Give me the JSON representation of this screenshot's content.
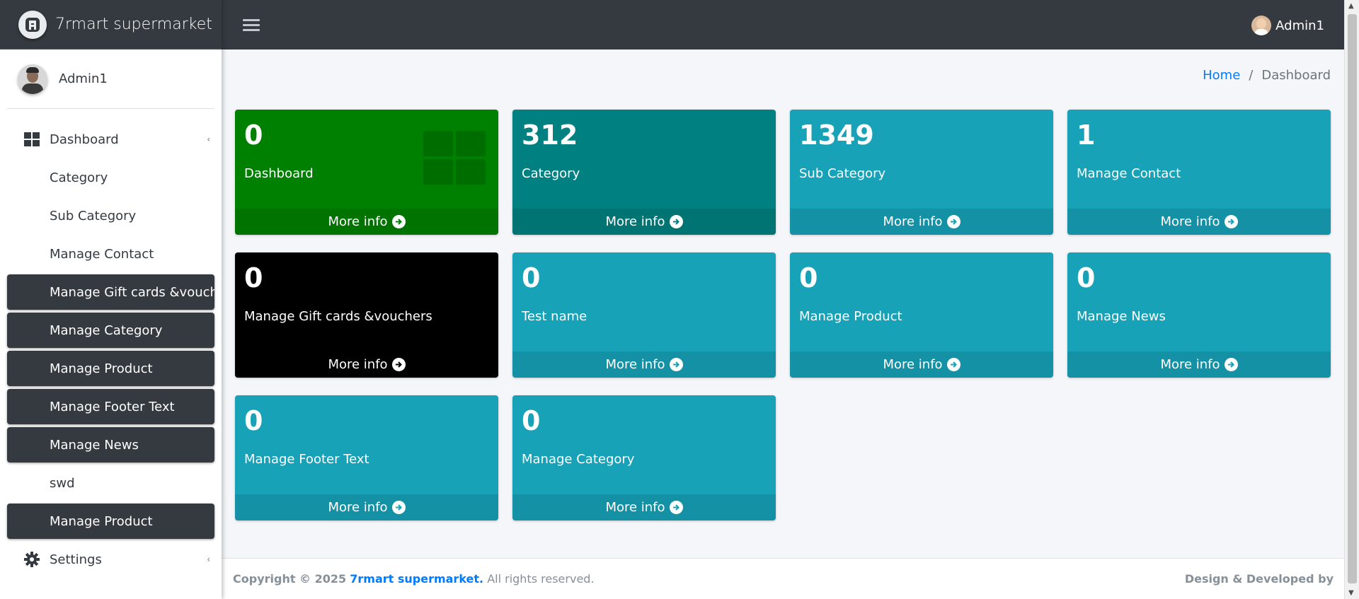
{
  "brand": {
    "name": "7rmart supermarket"
  },
  "sidebar": {
    "user": "Admin1",
    "items": [
      {
        "label": "Dashboard",
        "icon": "dashboard-icon",
        "type": "top"
      },
      {
        "label": "Category",
        "type": "sub"
      },
      {
        "label": "Sub Category",
        "type": "sub"
      },
      {
        "label": "Manage Contact",
        "type": "sub"
      },
      {
        "label": "Manage Gift cards &vouchers",
        "type": "active"
      },
      {
        "label": "Manage Category",
        "type": "active"
      },
      {
        "label": "Manage Product",
        "type": "active"
      },
      {
        "label": "Manage Footer Text",
        "type": "active"
      },
      {
        "label": "Manage News",
        "type": "active"
      },
      {
        "label": "swd",
        "type": "sub"
      },
      {
        "label": "Manage Product",
        "type": "active"
      },
      {
        "label": "Settings",
        "icon": "gear-icon",
        "type": "top"
      }
    ]
  },
  "topbar": {
    "user": "Admin1"
  },
  "breadcrumb": {
    "home": "Home",
    "separator": "/",
    "current": "Dashboard"
  },
  "boxes": [
    {
      "value": "0",
      "label": "Dashboard",
      "footer": "More info",
      "color": "#008000"
    },
    {
      "value": "312",
      "label": "Category",
      "footer": "More info",
      "color": "#008080"
    },
    {
      "value": "1349",
      "label": "Sub Category",
      "footer": "More info",
      "color": "#17a2b8"
    },
    {
      "value": "1",
      "label": "Manage Contact",
      "footer": "More info",
      "color": "#17a2b8"
    },
    {
      "value": "0",
      "label": "Manage Gift cards &vouchers",
      "footer": "More info",
      "color": "#000000"
    },
    {
      "value": "0",
      "label": "Test name",
      "footer": "More info",
      "color": "#17a2b8"
    },
    {
      "value": "0",
      "label": "Manage Product",
      "footer": "More info",
      "color": "#17a2b8"
    },
    {
      "value": "0",
      "label": "Manage News",
      "footer": "More info",
      "color": "#17a2b8"
    },
    {
      "value": "0",
      "label": "Manage Footer Text",
      "footer": "More info",
      "color": "#17a2b8"
    },
    {
      "value": "0",
      "label": "Manage Category",
      "footer": "More info",
      "color": "#17a2b8"
    }
  ],
  "footer": {
    "copyright_prefix": "Copyright © 2025",
    "brand_link": "7rmart supermarket.",
    "rights": "All rights reserved.",
    "right_text": "Design & Developed by"
  },
  "colors": {
    "navbar": "#343a40",
    "link": "#007bff",
    "info": "#17a2b8"
  }
}
